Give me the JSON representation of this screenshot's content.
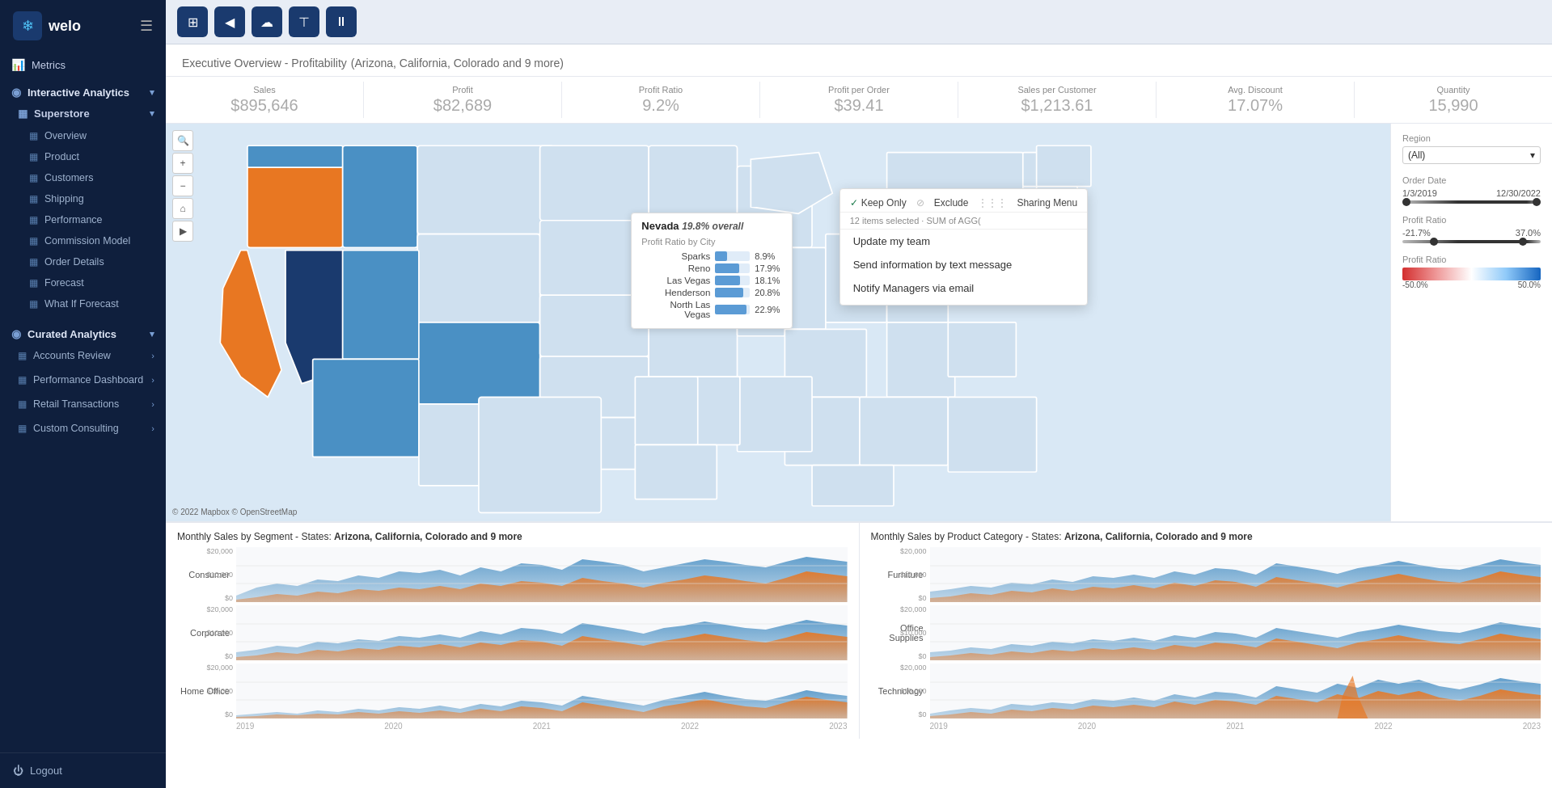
{
  "sidebar": {
    "logo_text": "welo",
    "metrics_label": "Metrics",
    "interactive_analytics_label": "Interactive Analytics",
    "superstore_label": "Superstore",
    "nav_items": [
      {
        "label": "Overview",
        "id": "overview"
      },
      {
        "label": "Product",
        "id": "product"
      },
      {
        "label": "Customers",
        "id": "customers"
      },
      {
        "label": "Shipping",
        "id": "shipping"
      },
      {
        "label": "Performance",
        "id": "performance"
      },
      {
        "label": "Commission Model",
        "id": "commission"
      },
      {
        "label": "Order Details",
        "id": "order-details"
      },
      {
        "label": "Forecast",
        "id": "forecast"
      },
      {
        "label": "What If Forecast",
        "id": "what-if-forecast"
      }
    ],
    "curated_analytics_label": "Curated Analytics",
    "curated_items": [
      {
        "label": "Accounts Review",
        "id": "accounts-review"
      },
      {
        "label": "Performance Dashboard",
        "id": "performance-dashboard"
      },
      {
        "label": "Retail Transactions",
        "id": "retail-transactions"
      },
      {
        "label": "Custom Consulting",
        "id": "custom-consulting"
      }
    ],
    "logout_label": "Logout"
  },
  "toolbar": {
    "buttons": [
      {
        "id": "home",
        "icon": "⊞",
        "label": "Home"
      },
      {
        "id": "arrow",
        "icon": "◀",
        "label": "Back"
      },
      {
        "id": "cloud",
        "icon": "☁",
        "label": "Cloud"
      },
      {
        "id": "tag",
        "icon": "⊤",
        "label": "Tag"
      },
      {
        "id": "pause",
        "icon": "⏸",
        "label": "Pause"
      }
    ]
  },
  "dashboard": {
    "title": "Executive Overview - Profitability",
    "subtitle": "(Arizona, California, Colorado and 9 more)",
    "kpis": [
      {
        "label": "Sales",
        "value": "$895,646"
      },
      {
        "label": "Profit",
        "value": "$82,689"
      },
      {
        "label": "Profit Ratio",
        "value": "9.2%"
      },
      {
        "label": "Profit per Order",
        "value": "$39.41"
      },
      {
        "label": "Sales per Customer",
        "value": "$1,213.61"
      },
      {
        "label": "Avg. Discount",
        "value": "17.07%"
      },
      {
        "label": "Quantity",
        "value": "15,990"
      }
    ],
    "filters": {
      "region_label": "Region",
      "region_value": "(All)",
      "order_date_label": "Order Date",
      "order_date_start": "1/3/2019",
      "order_date_end": "12/30/2022",
      "profit_ratio_label1": "Profit Ratio",
      "profit_ratio_min1": "-21.7%",
      "profit_ratio_max1": "37.0%",
      "profit_ratio_label2": "Profit Ratio",
      "profit_ratio_min2": "-50.0%",
      "profit_ratio_max2": "50.0%"
    },
    "nevada_popup": {
      "title": "Nevada",
      "overall": "19.8% overall",
      "subtitle": "Profit Ratio by City",
      "cities": [
        {
          "name": "Sparks",
          "value": "8.9%",
          "pct": 35
        },
        {
          "name": "Reno",
          "value": "17.9%",
          "pct": 70
        },
        {
          "name": "Las Vegas",
          "value": "18.1%",
          "pct": 71
        },
        {
          "name": "Henderson",
          "value": "20.8%",
          "pct": 80
        },
        {
          "name": "North Las Vegas",
          "value": "22.9%",
          "pct": 89
        }
      ]
    },
    "context_menu": {
      "keep_only": "Keep Only",
      "exclude": "Exclude",
      "sharing_menu": "Sharing Menu",
      "selected_info": "12 items selected · SUM of AGG(",
      "items": [
        "Update my team",
        "Send information by text message",
        "Notify Managers via email"
      ]
    },
    "map_copyright": "© 2022 Mapbox © OpenStreetMap",
    "chart_left_title": "Monthly Sales by Segment - States: ",
    "chart_left_states": "Arizona, California, Colorado and 9 more",
    "chart_right_title": "Monthly Sales by Product Category - States: ",
    "chart_right_states": "Arizona, California, Colorado and 9 more",
    "left_segments": [
      "Consumer",
      "Corporate",
      "Home Office"
    ],
    "right_categories": [
      "Furniture",
      "Office Supplies",
      "Technology"
    ],
    "x_axis_years": [
      "2019",
      "2020",
      "2021",
      "2022",
      "2023"
    ],
    "y_axis_labels": [
      "$20,000",
      "$10,000",
      "$0"
    ]
  }
}
